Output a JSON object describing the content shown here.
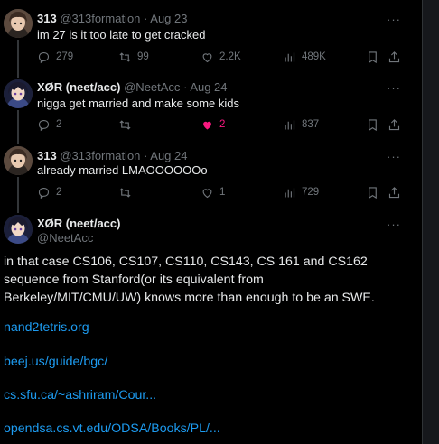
{
  "colors": {
    "background": "#000000",
    "text": "#e7e9ea",
    "secondary": "#71767b",
    "link": "#1d9bf0",
    "like_active": "#f91880"
  },
  "tweets": [
    {
      "name": "313",
      "handle": "@313formation",
      "sep": "·",
      "date": "Aug 23",
      "text": "im 27 is it too late to get cracked",
      "replies": "279",
      "retweets": "99",
      "likes": "2.2K",
      "views": "489K",
      "avatar": "anime-avatar-313"
    },
    {
      "name": "XØR (neet/acc)",
      "handle": "@NeetAcc",
      "sep": "·",
      "date": "Aug 24",
      "text": "nigga get married and make some kids",
      "replies": "2",
      "retweets": "",
      "likes": "2",
      "views": "837",
      "liked": true,
      "avatar": "anime-avatar-xor"
    },
    {
      "name": "313",
      "handle": "@313formation",
      "sep": "·",
      "date": "Aug 24",
      "text": "already married LMAOOOOOOo",
      "replies": "2",
      "retweets": "",
      "likes": "1",
      "views": "729",
      "avatar": "anime-avatar-313"
    }
  ],
  "main_tweet": {
    "name": "XØR (neet/acc)",
    "handle": "@NeetAcc",
    "text": "in that case CS106, CS107, CS110, CS143, CS 161 and CS162 sequence from Stanford(or its equivalent from Berkeley/MIT/CMU/UW) knows more than enough to be an SWE.",
    "links": [
      "nand2tetris.org",
      "beej.us/guide/bgc/",
      "cs.sfu.ca/~ashriram/Cour...",
      "opendsa.cs.vt.edu/ODSA/Books/PL/..."
    ]
  },
  "icons": {
    "more": "more-horizontal-icon",
    "reply": "reply-icon",
    "retweet": "retweet-icon",
    "like": "heart-icon",
    "views": "views-icon",
    "bookmark": "bookmark-icon",
    "share": "share-icon"
  },
  "more_glyph": "···"
}
